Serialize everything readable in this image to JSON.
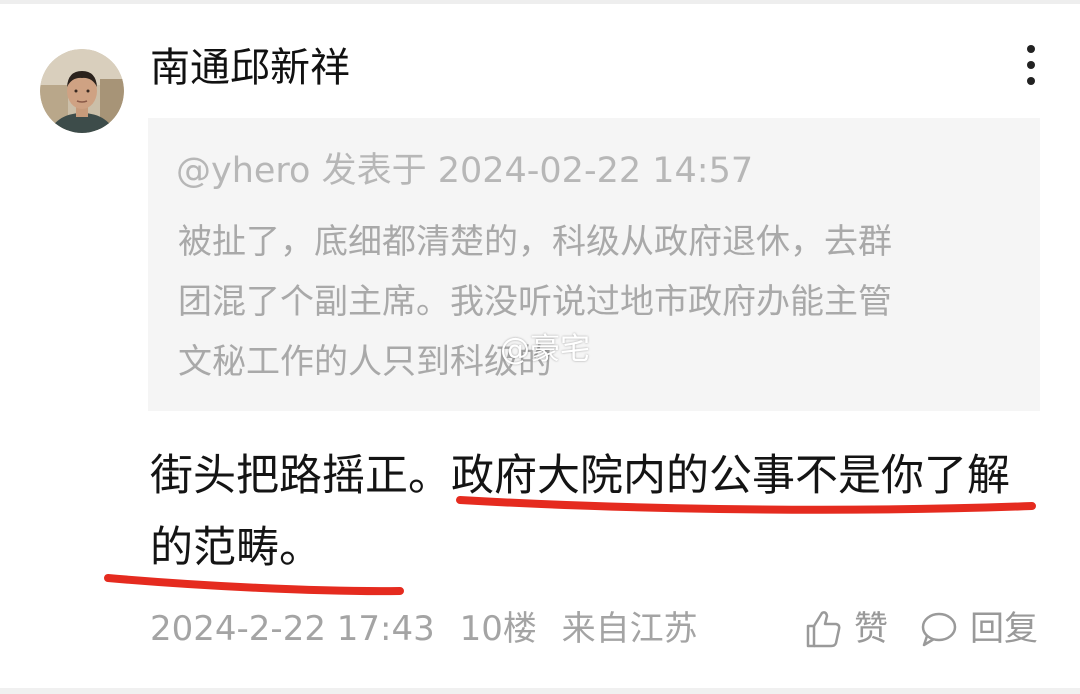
{
  "author": {
    "name": "南通邱新祥",
    "avatar_icon": "user-avatar"
  },
  "quote": {
    "meta": "@yhero 发表于 2024-02-22 14:57",
    "lines": [
      "被扯了，底细都清楚的，科级从政府退休，去群",
      "团混了个副主席。我没听说过地市政府办能主管",
      "文秘工作的人只到科级的"
    ]
  },
  "watermark": "@豪宅",
  "reply": {
    "line1_plain": "街头把路摇正。",
    "line1_highlight": "政府大院内的公事不是你了解",
    "line2_highlight": "的范畴。"
  },
  "footer": {
    "time": "2024-2-22 17:43",
    "floor": "10楼",
    "location": "来自江苏",
    "like_label": "赞",
    "reply_label": "回复"
  },
  "icons": {
    "more": "more-vertical-icon",
    "like": "thumbs-up-icon",
    "reply": "comment-bubble-icon"
  },
  "colors": {
    "underline": "#e52b1f",
    "quote_bg": "#f5f5f5",
    "muted_text": "#a4a4a4"
  }
}
